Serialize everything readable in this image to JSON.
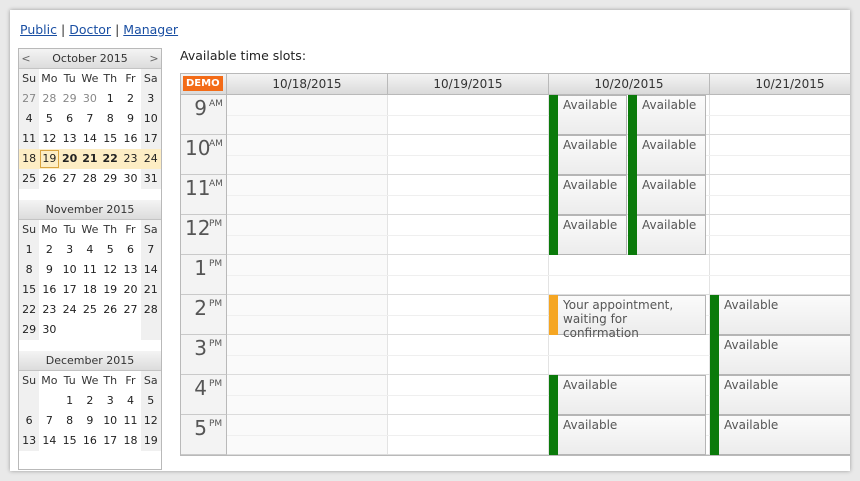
{
  "nav": [
    "Public",
    "Doctor",
    "Manager"
  ],
  "title": "Available time slots:",
  "demo_badge": "DEMO",
  "colors": {
    "available": "#0a7a0a",
    "pending": "#f5a623",
    "week_highlight": "#fdedc4"
  },
  "icons": {
    "prev": "chevron-left-icon",
    "next": "chevron-right-icon"
  },
  "mini_calendar": {
    "prev_label": "<",
    "next_label": ">",
    "dow": [
      "Su",
      "Mo",
      "Tu",
      "We",
      "Th",
      "Fr",
      "Sa"
    ],
    "months": [
      {
        "name": "October 2015",
        "rows": [
          [
            "27",
            "28",
            "29",
            "30",
            "1",
            "2",
            "3"
          ],
          [
            "4",
            "5",
            "6",
            "7",
            "8",
            "9",
            "10"
          ],
          [
            "11",
            "12",
            "13",
            "14",
            "15",
            "16",
            "17"
          ],
          [
            "18",
            "19",
            "20",
            "21",
            "22",
            "23",
            "24"
          ],
          [
            "25",
            "26",
            "27",
            "28",
            "29",
            "30",
            "31"
          ]
        ]
      },
      {
        "name": "November 2015",
        "rows": [
          [
            "1",
            "2",
            "3",
            "4",
            "5",
            "6",
            "7"
          ],
          [
            "8",
            "9",
            "10",
            "11",
            "12",
            "13",
            "14"
          ],
          [
            "15",
            "16",
            "17",
            "18",
            "19",
            "20",
            "21"
          ],
          [
            "22",
            "23",
            "24",
            "25",
            "26",
            "27",
            "28"
          ],
          [
            "29",
            "30",
            "",
            "",
            "",
            "",
            ""
          ]
        ]
      },
      {
        "name": "December 2015",
        "rows": [
          [
            "",
            "",
            "1",
            "2",
            "3",
            "4",
            "5"
          ],
          [
            "6",
            "7",
            "8",
            "9",
            "10",
            "11",
            "12"
          ],
          [
            "13",
            "14",
            "15",
            "16",
            "17",
            "18",
            "19"
          ]
        ]
      }
    ]
  },
  "scheduler": {
    "columns": [
      "10/18/2015",
      "10/19/2015",
      "10/20/2015",
      "10/21/2015"
    ],
    "hours": [
      {
        "h": "9",
        "ap": "AM"
      },
      {
        "h": "10",
        "ap": "AM"
      },
      {
        "h": "11",
        "ap": "AM"
      },
      {
        "h": "12",
        "ap": "PM"
      },
      {
        "h": "1",
        "ap": "PM"
      },
      {
        "h": "2",
        "ap": "PM"
      },
      {
        "h": "3",
        "ap": "PM"
      },
      {
        "h": "4",
        "ap": "PM"
      },
      {
        "h": "5",
        "ap": "PM"
      }
    ],
    "events": [
      {
        "day": 2,
        "lane": 0,
        "start": 0,
        "end": 1,
        "text": "Available",
        "status": "available"
      },
      {
        "day": 2,
        "lane": 0,
        "start": 1,
        "end": 2,
        "text": "Available",
        "status": "available"
      },
      {
        "day": 2,
        "lane": 0,
        "start": 2,
        "end": 3,
        "text": "Available",
        "status": "available"
      },
      {
        "day": 2,
        "lane": 0,
        "start": 3,
        "end": 4,
        "text": "Available",
        "status": "available"
      },
      {
        "day": 2,
        "lane": 1,
        "start": 0,
        "end": 1,
        "text": "Available",
        "status": "available"
      },
      {
        "day": 2,
        "lane": 1,
        "start": 1,
        "end": 2,
        "text": "Available",
        "status": "available"
      },
      {
        "day": 2,
        "lane": 1,
        "start": 2,
        "end": 3,
        "text": "Available",
        "status": "available"
      },
      {
        "day": 2,
        "lane": 1,
        "start": 3,
        "end": 4,
        "text": "Available",
        "status": "available"
      },
      {
        "day": 2,
        "lane": -1,
        "start": 5,
        "end": 6,
        "text": "Your appointment, waiting for confirmation",
        "status": "pending"
      },
      {
        "day": 2,
        "lane": -1,
        "start": 7,
        "end": 8,
        "text": "Available",
        "status": "available"
      },
      {
        "day": 2,
        "lane": -1,
        "start": 8,
        "end": 9,
        "text": "Available",
        "status": "available"
      },
      {
        "day": 3,
        "lane": -1,
        "start": 5,
        "end": 6,
        "text": "Available",
        "status": "available"
      },
      {
        "day": 3,
        "lane": -1,
        "start": 6,
        "end": 7,
        "text": "Available",
        "status": "available"
      },
      {
        "day": 3,
        "lane": -1,
        "start": 7,
        "end": 8,
        "text": "Available",
        "status": "available"
      },
      {
        "day": 3,
        "lane": -1,
        "start": 8,
        "end": 9,
        "text": "Available",
        "status": "available"
      }
    ]
  }
}
